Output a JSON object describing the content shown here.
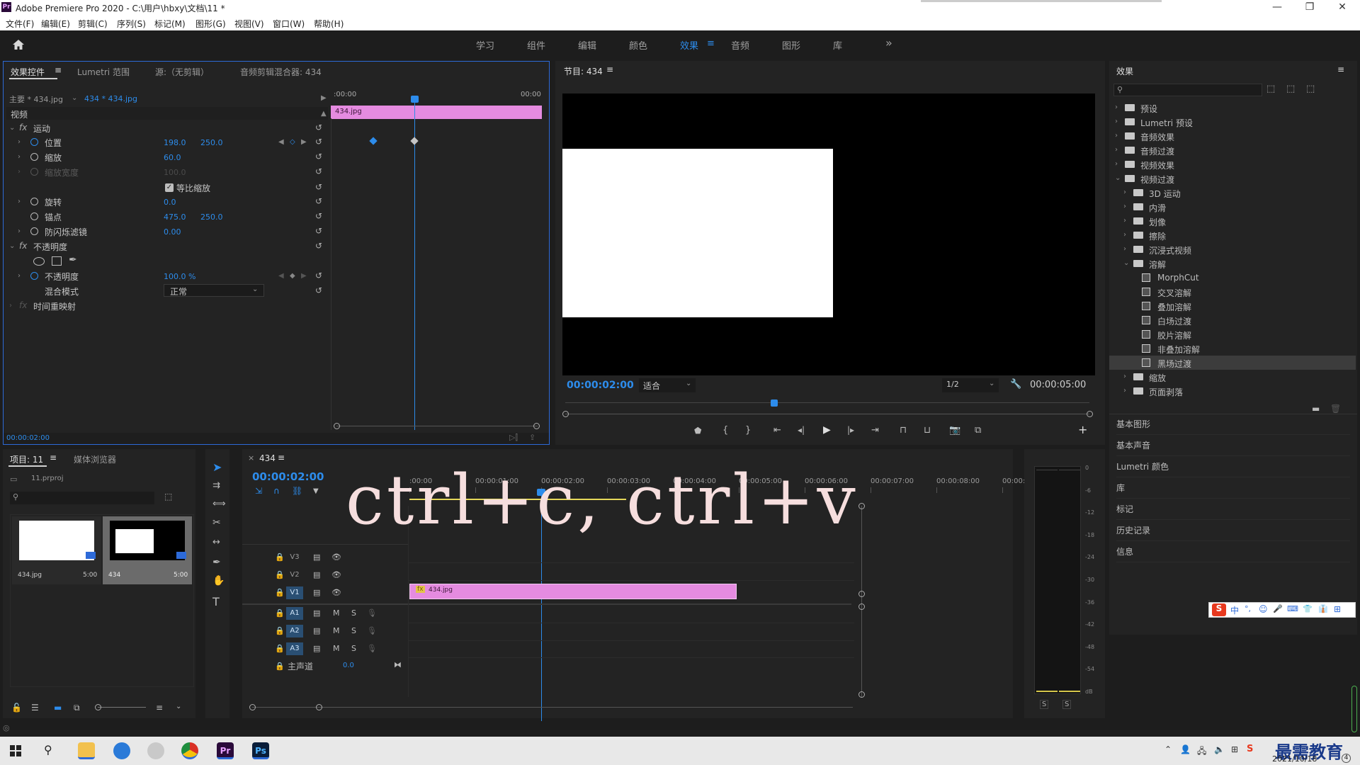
{
  "window": {
    "app_badge": "Pr",
    "title": "Adobe Premiere Pro 2020 - C:\\用户\\hbxy\\文档\\11 *"
  },
  "menu": [
    "文件(F)",
    "编辑(E)",
    "剪辑(C)",
    "序列(S)",
    "标记(M)",
    "图形(G)",
    "视图(V)",
    "窗口(W)",
    "帮助(H)"
  ],
  "workspaces": [
    "学习",
    "组件",
    "编辑",
    "颜色",
    "效果",
    "音频",
    "图形",
    "库"
  ],
  "workspaces_active": "效果",
  "effect_controls": {
    "tabs": [
      "效果控件",
      "Lumetri 范围",
      "源:（无剪辑）",
      "音频剪辑混合器: 434"
    ],
    "master_label": "主要 * 434.jpg",
    "clip_label": "434 * 434.jpg",
    "time_start": ":00:00",
    "time_end": "00:00",
    "clip_name": "434.jpg",
    "section_video": "视频",
    "motion": "运动",
    "position_label": "位置",
    "position_x": "198.0",
    "position_y": "250.0",
    "scale_label": "缩放",
    "scale_val": "60.0",
    "scale_width_label": "缩放宽度",
    "scale_width_val": "100.0",
    "uniform_label": "等比缩放",
    "rotation_label": "旋转",
    "rotation_val": "0.0",
    "anchor_label": "锚点",
    "anchor_x": "475.0",
    "anchor_y": "250.0",
    "flicker_label": "防闪烁滤镜",
    "flicker_val": "0.00",
    "opacity_section": "不透明度",
    "opacity_label": "不透明度",
    "opacity_val": "100.0 %",
    "blend_label": "混合模式",
    "blend_val": "正常",
    "time_remap": "时间重映射",
    "current_time": "00:00:02:00"
  },
  "program": {
    "title": "节目: 434",
    "timecode": "00:00:02:00",
    "fit": "适合",
    "resolution": "1/2",
    "duration": "00:00:05:00"
  },
  "effects_panel": {
    "title": "效果",
    "tree": [
      {
        "label": "预设",
        "level": 0,
        "kind": "folder-special",
        "open": false
      },
      {
        "label": "Lumetri 预设",
        "level": 0,
        "kind": "folder-special",
        "open": false
      },
      {
        "label": "音频效果",
        "level": 0,
        "kind": "folder",
        "open": false
      },
      {
        "label": "音频过渡",
        "level": 0,
        "kind": "folder",
        "open": false
      },
      {
        "label": "视频效果",
        "level": 0,
        "kind": "folder",
        "open": false
      },
      {
        "label": "视频过渡",
        "level": 0,
        "kind": "folder",
        "open": true
      },
      {
        "label": "3D 运动",
        "level": 1,
        "kind": "folder",
        "open": false
      },
      {
        "label": "内滑",
        "level": 1,
        "kind": "folder",
        "open": false
      },
      {
        "label": "划像",
        "level": 1,
        "kind": "folder",
        "open": false
      },
      {
        "label": "擦除",
        "level": 1,
        "kind": "folder",
        "open": false
      },
      {
        "label": "沉浸式视频",
        "level": 1,
        "kind": "folder",
        "open": false
      },
      {
        "label": "溶解",
        "level": 1,
        "kind": "folder",
        "open": true
      },
      {
        "label": "MorphCut",
        "level": 2,
        "kind": "fx"
      },
      {
        "label": "交叉溶解",
        "level": 2,
        "kind": "fx"
      },
      {
        "label": "叠加溶解",
        "level": 2,
        "kind": "fx"
      },
      {
        "label": "白场过渡",
        "level": 2,
        "kind": "fx"
      },
      {
        "label": "胶片溶解",
        "level": 2,
        "kind": "fx"
      },
      {
        "label": "非叠加溶解",
        "level": 2,
        "kind": "fx"
      },
      {
        "label": "黑场过渡",
        "level": 2,
        "kind": "fx",
        "selected": true
      },
      {
        "label": "缩放",
        "level": 1,
        "kind": "folder",
        "open": false
      },
      {
        "label": "页面剥落",
        "level": 1,
        "kind": "folder",
        "open": false
      }
    ],
    "side_panels": [
      "基本图形",
      "基本声音",
      "Lumetri 颜色",
      "库",
      "标记",
      "历史记录",
      "信息"
    ]
  },
  "project": {
    "tabs": [
      "项目: 11",
      "媒体浏览器"
    ],
    "file": "11.prproj",
    "items": [
      {
        "name": "434.jpg",
        "duration": "5:00"
      },
      {
        "name": "434",
        "duration": "5:00"
      }
    ]
  },
  "timeline": {
    "seq_name": "434",
    "timecode": "00:00:02:00",
    "ruler": [
      ":00:00",
      "00:00:01:00",
      "00:00:02:00",
      "00:00:03:00",
      "00:00:04:00",
      "00:00:05:00",
      "00:00:06:00",
      "00:00:07:00",
      "00:00:08:00",
      "00:00:0"
    ],
    "video_tracks": [
      "V3",
      "V2",
      "V1"
    ],
    "audio_tracks": [
      "A1",
      "A2",
      "A3"
    ],
    "master": "主声道",
    "master_val": "0.0",
    "clip": "434.jpg",
    "overlay": "ctrl+c, ctrl+v"
  },
  "meter": {
    "scale": [
      "0",
      "-6",
      "-12",
      "-18",
      "-24",
      "-30",
      "-36",
      "-42",
      "-48",
      "-54",
      "dB"
    ],
    "solo": [
      "S",
      "S"
    ]
  },
  "ime": {
    "chars": [
      "中",
      "°,",
      "☺",
      "🎤",
      "⌨",
      "👕",
      "👔",
      "⊞"
    ]
  },
  "taskbar": {
    "date": "2021/10/18",
    "watermark": "最需教育",
    "badge": "4"
  },
  "colors": {
    "accent": "#2d8ceb",
    "clip_pink": "#e58be0",
    "panel_bg": "#232323",
    "app_bg": "#1d1d1d"
  }
}
